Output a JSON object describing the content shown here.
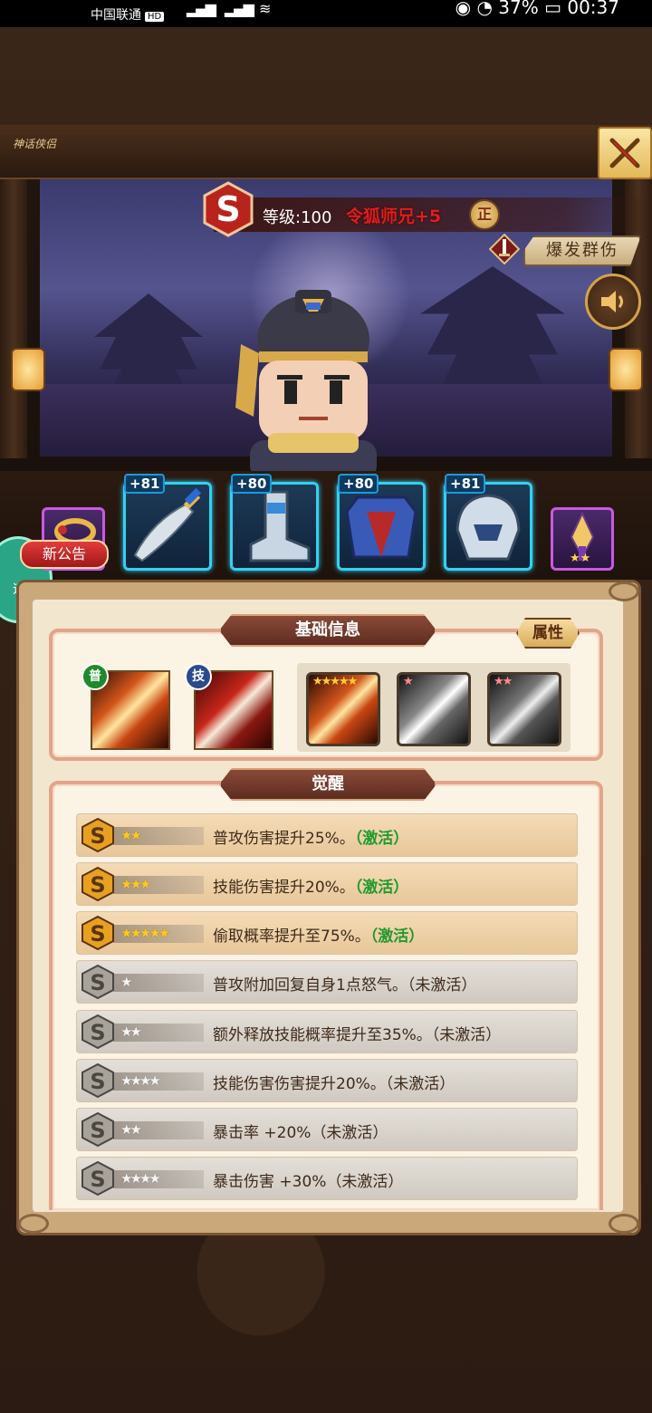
{
  "status_bar": {
    "carrier": "中国联通",
    "hd": "HD",
    "battery": "37%",
    "time": "00:37"
  },
  "hero": {
    "level_label": "等级:100",
    "name": "令狐师兄+5",
    "alignment_badge": "正",
    "skill_tag": "爆发群伤",
    "logo_text": "神话侠侣"
  },
  "equipment": [
    {
      "plus": "+81",
      "icon": "blade-icon"
    },
    {
      "plus": "+80",
      "icon": "boot-icon"
    },
    {
      "plus": "+80",
      "icon": "armor-icon"
    },
    {
      "plus": "+81",
      "icon": "helmet-icon"
    }
  ],
  "side_items": {
    "left_icon": "bracelet-icon",
    "right_icon": "sword-treasure-icon",
    "right_stars": "★★"
  },
  "announce": "新公告",
  "speed_label": "速",
  "basic_info": {
    "title": "基础信息",
    "attr_button": "属性",
    "skills": [
      {
        "badge": "普",
        "badge_color": "#1f8a2b"
      },
      {
        "badge": "技",
        "badge_color": "#2a4a8a"
      }
    ],
    "weapon_stars": [
      "★★★★★",
      "★",
      "★★"
    ]
  },
  "awaken": {
    "title": "觉醒",
    "rows": [
      {
        "stars": "★★",
        "text": "普攻伤害提升25%。",
        "status": "（激活）",
        "active": true
      },
      {
        "stars": "★★★",
        "text": "技能伤害提升20%。",
        "status": "（激活）",
        "active": true
      },
      {
        "stars": "★★★★★",
        "text": "偷取概率提升至75%。",
        "status": "（激活）",
        "active": true
      },
      {
        "stars": "★",
        "text": "普攻附加回复自身1点怒气。",
        "status": "（未激活）",
        "active": false
      },
      {
        "stars": "★★",
        "text": "额外释放技能概率提升至35%。",
        "status": "（未激活）",
        "active": false
      },
      {
        "stars": "★★★★",
        "text": "技能伤害伤害提升20%。",
        "status": "（未激活）",
        "active": false
      },
      {
        "stars": "★★",
        "text": "暴击率 +20%",
        "status": "（未激活）",
        "active": false
      },
      {
        "stars": "★★★★",
        "text": "暴击伤害 +30%",
        "status": "（未激活）",
        "active": false
      }
    ]
  },
  "colors": {
    "active_green": "#1f9a2b",
    "name_red": "#e21d1d",
    "equip_border": "#2fd3f0"
  }
}
